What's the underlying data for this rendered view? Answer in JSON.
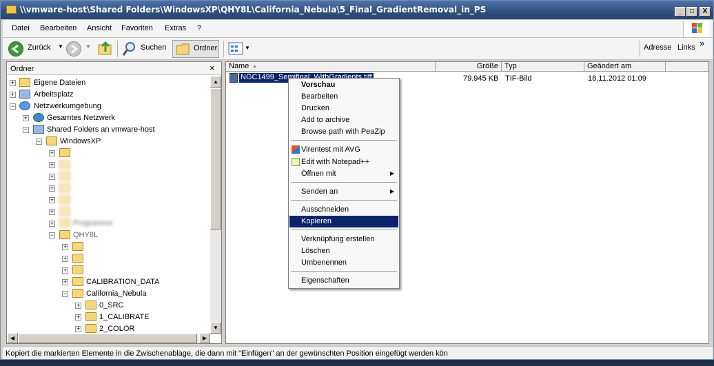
{
  "window": {
    "title": "\\\\vmware-host\\Shared Folders\\WindowsXP\\QHY8L\\California_Nebula\\5_Final_GradientRemoval_in_PS",
    "minimize": "_",
    "maximize": "□",
    "close": "X"
  },
  "menubar": {
    "items": [
      "Datei",
      "Bearbeiten",
      "Ansicht",
      "Favoriten",
      "Extras",
      "?"
    ]
  },
  "toolbar": {
    "back_label": "Zurück",
    "search_label": "Suchen",
    "folders_label": "Ordner",
    "address_label": "Adresse",
    "links_label": "Links",
    "more": "»"
  },
  "folder_pane": {
    "title": "Ordner",
    "close": "×",
    "tree": [
      {
        "label": "Eigene Dateien",
        "exp": "+"
      },
      {
        "label": "Arbeitsplatz",
        "exp": "+"
      },
      {
        "label": "Netzwerkumgebung",
        "exp": "−"
      },
      {
        "label": "Gesamtes Netzwerk",
        "exp": "+"
      },
      {
        "label": "Shared Folders an vmware-host",
        "exp": "−"
      },
      {
        "label": "WindowsXP",
        "exp": "−"
      },
      {
        "label": "",
        "exp": "+"
      },
      {
        "label": "",
        "exp": "+"
      },
      {
        "label": "",
        "exp": "+"
      },
      {
        "label": "",
        "exp": "+"
      },
      {
        "label": "",
        "exp": "+"
      },
      {
        "label": "",
        "exp": "+"
      },
      {
        "label": "Programme",
        "exp": "+"
      },
      {
        "label": "QHY8L",
        "exp": "−"
      },
      {
        "label": "",
        "exp": "+"
      },
      {
        "label": "",
        "exp": "+"
      },
      {
        "label": "",
        "exp": "+"
      },
      {
        "label": "CALIBRATION_DATA",
        "exp": "+"
      },
      {
        "label": "California_Nebula",
        "exp": "−"
      },
      {
        "label": "0_SRC",
        "exp": "+"
      },
      {
        "label": "1_CALIBRATE",
        "exp": "+"
      },
      {
        "label": "2_COLOR",
        "exp": "+"
      }
    ]
  },
  "file_list": {
    "columns": [
      "Name",
      "Größe",
      "Typ",
      "Geändert am"
    ],
    "rows": [
      {
        "name": "NGC1499_Semifinal_WithGradients.tiff",
        "size": "79.945 KB",
        "type": "TIF-Bild",
        "modified": "18.11.2012 01:09"
      }
    ]
  },
  "context_menu": {
    "items": [
      {
        "label": "Vorschau"
      },
      {
        "label": "Bearbeiten"
      },
      {
        "label": "Drucken"
      },
      {
        "label": "Add to archive"
      },
      {
        "label": "Browse path with PeaZip"
      },
      {
        "label": "Virentest mit AVG"
      },
      {
        "label": "Edit with Notepad++"
      },
      {
        "label": "Öffnen mit"
      },
      {
        "label": "Senden an"
      },
      {
        "label": "Ausschneiden"
      },
      {
        "label": "Kopieren"
      },
      {
        "label": "Verknüpfung erstellen"
      },
      {
        "label": "Löschen"
      },
      {
        "label": "Umbenennen"
      },
      {
        "label": "Eigenschaften"
      }
    ],
    "submenu_arrow": "▶"
  },
  "status": {
    "text": "Kopiert die markierten Elemente in die Zwischenablage, die dann mit \"Einfügen\" an der gewünschten Position eingefügt werden kön"
  },
  "colors": {
    "selection": "#0a246a",
    "titlebar": "#2f4f7e",
    "folder": "#f5d67a"
  }
}
